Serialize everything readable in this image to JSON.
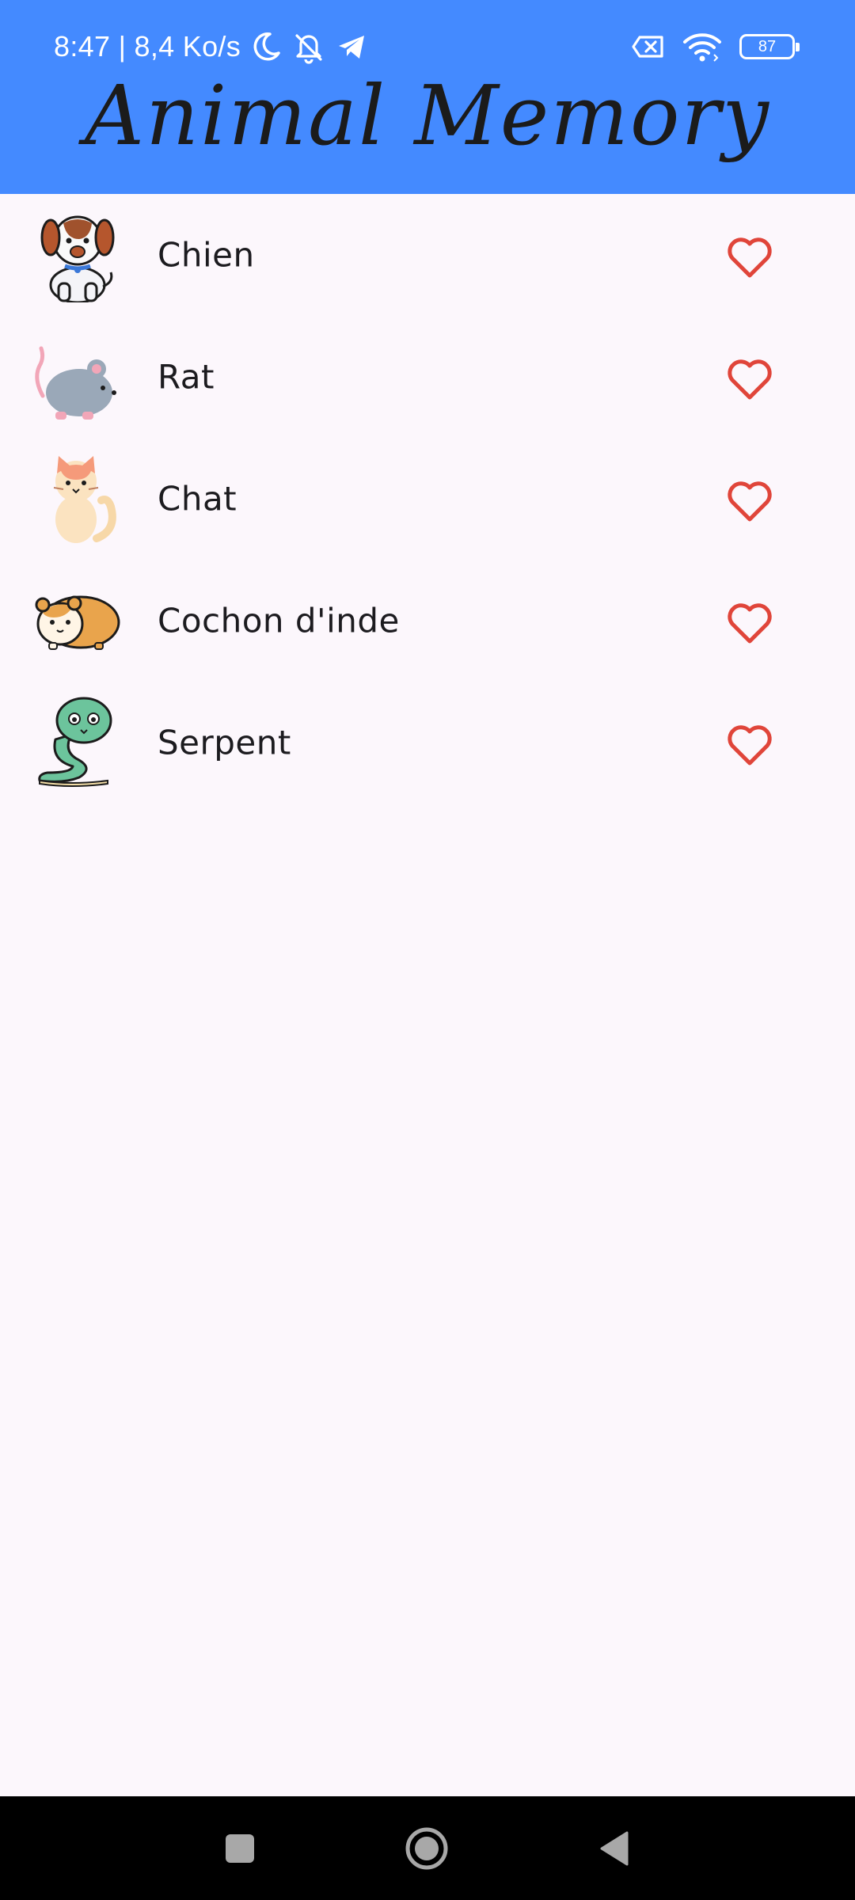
{
  "status_bar": {
    "time_and_speed": "8:47 | 8,4 Ko/s",
    "battery_level": "87",
    "icons": [
      "moon-icon",
      "bell-off-icon",
      "telegram-icon",
      "no-sim-icon",
      "wifi-icon",
      "battery-icon"
    ]
  },
  "app": {
    "title": "Animal Memory"
  },
  "animals": [
    {
      "name": "Chien",
      "icon": "dog-icon",
      "favorite": false
    },
    {
      "name": "Rat",
      "icon": "rat-icon",
      "favorite": false
    },
    {
      "name": "Chat",
      "icon": "cat-icon",
      "favorite": false
    },
    {
      "name": "Cochon d'inde",
      "icon": "guinea-pig-icon",
      "favorite": false
    },
    {
      "name": "Serpent",
      "icon": "snake-icon",
      "favorite": false
    }
  ],
  "colors": {
    "app_bar": "#448AFF",
    "background": "#FCF7FC",
    "heart": "#E0453A",
    "nav_bar": "#000000"
  },
  "nav_bar": {
    "buttons": [
      "recents-button",
      "home-button",
      "back-button"
    ]
  }
}
